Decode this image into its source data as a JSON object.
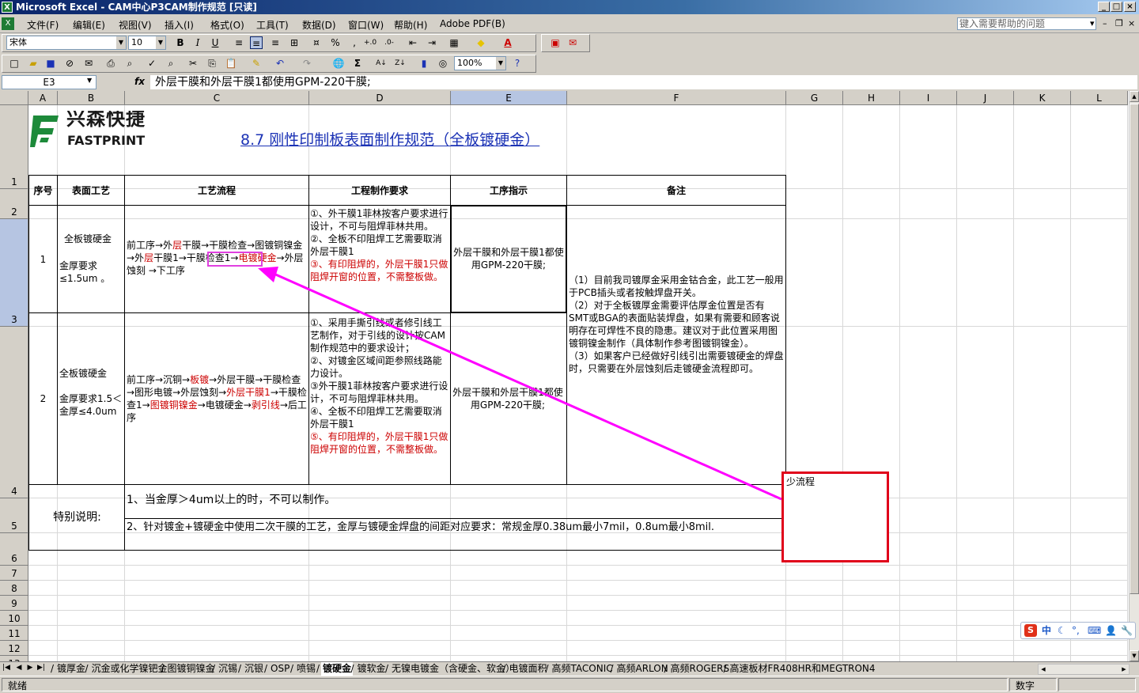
{
  "title": "Microsoft Excel - CAM中心P3CAM制作规范 [只读]",
  "menu": [
    "文件(F)",
    "编辑(E)",
    "视图(V)",
    "插入(I)",
    "格式(O)",
    "工具(T)",
    "数据(D)",
    "窗口(W)",
    "帮助(H)",
    "Adobe PDF(B)"
  ],
  "help_placeholder": "键入需要帮助的问题",
  "toolbar": {
    "font": "宋体",
    "size": "10",
    "zoom": "100%",
    "percent": "%",
    "comma": ","
  },
  "name_box": "E3",
  "formula": "外层干膜和外层干膜1都使用GPM-220干膜;",
  "columns": [
    "A",
    "B",
    "C",
    "D",
    "E",
    "F",
    "G",
    "H",
    "I",
    "J",
    "K",
    "L"
  ],
  "rows": [
    "1",
    "2",
    "3",
    "4",
    "5",
    "6",
    "7",
    "8",
    "9",
    "10",
    "11",
    "12",
    "13"
  ],
  "logo": {
    "cn": "兴森快捷",
    "en": "FASTPRINT"
  },
  "doc_title": "8.7 刚性印制板表面制作规范（全板镀硬金）",
  "headers": {
    "seq": "序号",
    "surface": "表面工艺",
    "flow": "工艺流程",
    "req": "工程制作要求",
    "instr": "工序指示",
    "note": "备注"
  },
  "row1": {
    "seq": "1",
    "surface": "全板镀硬金",
    "thickness": "金厚要求≤1.5um 。",
    "flow": [
      {
        "t": "前工序→外"
      },
      {
        "t": "层",
        "red": true
      },
      {
        "t": "干膜→干膜检查→图镀铜镍金→外"
      },
      {
        "t": "层",
        "red": true
      },
      {
        "t": "干膜1→干膜检查1→"
      },
      {
        "t": "电镀硬金",
        "red": true
      },
      {
        "t": "→外层蚀刻 →下工序"
      }
    ],
    "req": [
      {
        "t": "①、外干膜1菲林按客户要求进行设计，不可与阻焊菲林共用。"
      },
      {
        "t": "②、全板不印阻焊工艺需要取消外层干膜1"
      },
      {
        "t": "③、有印阻焊的，外层干膜1只做阻焊开窗的位置，不需整板做。",
        "red": true
      }
    ],
    "instr": "外层干膜和外层干膜1都使用GPM-220干膜;"
  },
  "row2": {
    "seq": "2",
    "surface": "全板镀硬金",
    "thickness": "金厚要求1.5＜金厚≤4.0um",
    "flow": [
      {
        "t": "前工序→沉铜→"
      },
      {
        "t": "板镀",
        "red": true
      },
      {
        "t": "→外层干膜→干膜检查→图形电镀→外层蚀刻→"
      },
      {
        "t": "外层干膜1",
        "red": true
      },
      {
        "t": "→干膜检查1→"
      },
      {
        "t": "图镀铜镍金",
        "red": true
      },
      {
        "t": "→电镀硬金→"
      },
      {
        "t": "剥引线",
        "red": true
      },
      {
        "t": "→后工序"
      }
    ],
    "req": [
      {
        "t": "①、采用手撕引线或者修引线工艺制作，对于引线的设计按CAM制作规范中的要求设计；"
      },
      {
        "t": "②、对镀金区域间距参照线路能力设计。"
      },
      {
        "t": "③外干膜1菲林按客户要求进行设计，不可与阻焊菲林共用。"
      },
      {
        "t": "④、全板不印阻焊工艺需要取消外层干膜1"
      },
      {
        "t": "⑤、有印阻焊的，外层干膜1只做阻焊开窗的位置，不需整板做。",
        "red": true
      }
    ],
    "instr": "外层干膜和外层干膜1都使用GPM-220干膜;"
  },
  "note": "（1）目前我司镀厚金采用金钴合金，此工艺一般用于PCB插头或者按触焊盘开关。\n（2）对于全板镀厚金需要评估厚金位置是否有SMT或BGA的表面贴装焊盘，如果有需要和顾客说明存在可焊性不良的隐患。建议对于此位置采用图镀铜镍金制作（具体制作参考图镀铜镍金）。\n（3）如果客户已经做好引线引出需要镀硬金的焊盘时，只需要在外层蚀刻后走镀硬金流程即可。",
  "special": {
    "label": "特别说明:",
    "line1": "1、当金厚＞4um以上的时，不可以制作。",
    "line2": "2、针对镀金+镀硬金中使用二次干膜的工艺，金厚与镀硬金焊盘的间距对应要求：常规金厚0.38um最小7mil，0.8um最小8mil."
  },
  "annotation": "少流程",
  "sheet_tabs": [
    "镀厚金",
    "沉金或化学镍钯金",
    "图镀铜镍金",
    "沉锡",
    "沉银",
    "OSP",
    "喷锡",
    "镀硬金",
    "镀软金",
    "无镍电镀金（含硬金、软金）",
    "电镀面积",
    "高频TACONIC",
    "高频ARLON",
    "高频ROGERS",
    "高速板材FR408HR和MEGTRON4"
  ],
  "active_tab": "镀硬金",
  "status": {
    "left": "就绪",
    "right": "数字"
  },
  "ime": {
    "label": "中"
  },
  "colors": {
    "accent": "#ff00ff",
    "annotation_border": "#e0001a",
    "red_text": "#cc0000",
    "title_blue": "#1b32b5"
  }
}
